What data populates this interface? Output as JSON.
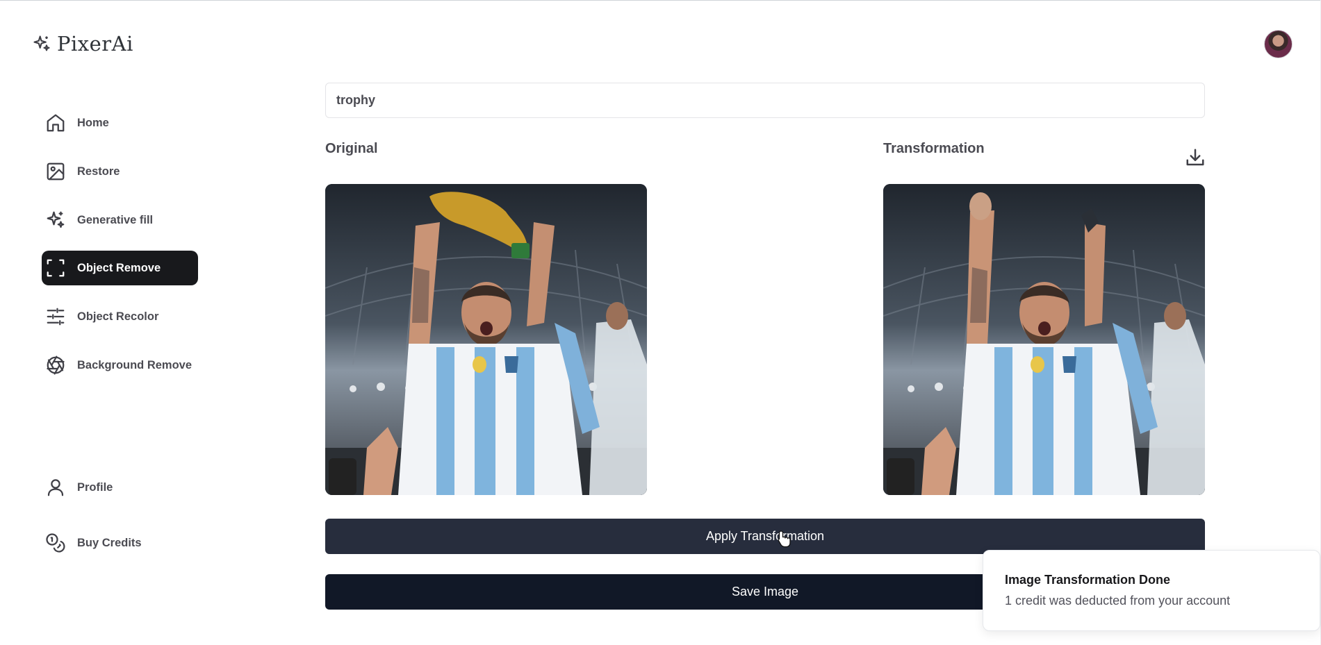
{
  "app": {
    "name": "PixerAi",
    "logo_icon": "sparkles-icon"
  },
  "sidebar": {
    "items": [
      {
        "label": "Home",
        "icon": "home-icon",
        "active": false
      },
      {
        "label": "Restore",
        "icon": "image-icon",
        "active": false
      },
      {
        "label": "Generative fill",
        "icon": "sparkles-icon",
        "active": false
      },
      {
        "label": "Object Remove",
        "icon": "scan-icon",
        "active": true
      },
      {
        "label": "Object Recolor",
        "icon": "sliders-icon",
        "active": false
      },
      {
        "label": "Background Remove",
        "icon": "aperture-icon",
        "active": false
      }
    ],
    "bottom_items": [
      {
        "label": "Profile",
        "icon": "user-icon"
      },
      {
        "label": "Buy Credits",
        "icon": "coins-icon"
      }
    ]
  },
  "form": {
    "object_value": "trophy"
  },
  "original": {
    "title": "Original"
  },
  "transformation": {
    "title": "Transformation"
  },
  "buttons": {
    "apply": "Apply Transformation",
    "save": "Save Image"
  },
  "toast": {
    "title": "Image Transformation Done",
    "description": "1 credit was deducted from your account"
  },
  "colors": {
    "active_nav_bg": "#18191c",
    "apply_button_bg": "#272d3d",
    "save_button_bg": "#111827"
  }
}
